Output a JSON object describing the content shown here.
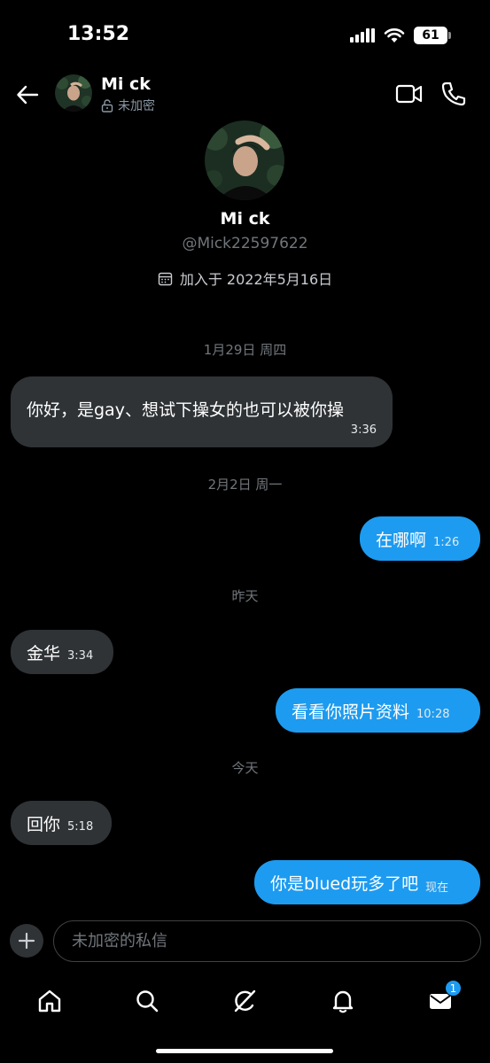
{
  "status_bar": {
    "time": "13:52",
    "battery": "61"
  },
  "header": {
    "name": "Mi ck",
    "encryption_status": "未加密",
    "icons": {
      "back": "back-arrow-icon",
      "video": "video-call-icon",
      "phone": "phone-call-icon",
      "lock": "unlock-icon"
    }
  },
  "profile": {
    "name": "Mi ck",
    "handle": "@Mick22597622",
    "joined": "加入于 2022年5月16日"
  },
  "messages": [
    {
      "type": "date",
      "text": "1月29日 周四"
    },
    {
      "type": "received",
      "text": "你好，是gay、想试下操女的也可以被你操",
      "time": "3:36"
    },
    {
      "type": "date",
      "text": "2月2日 周一"
    },
    {
      "type": "sent",
      "text": "在哪啊",
      "time": "1:26"
    },
    {
      "type": "date",
      "text": "昨天"
    },
    {
      "type": "received",
      "text": "金华",
      "time": "3:34"
    },
    {
      "type": "sent",
      "text": "看看你照片资料",
      "time": "10:28"
    },
    {
      "type": "date",
      "text": "今天"
    },
    {
      "type": "received",
      "text": "回你",
      "time": "5:18"
    },
    {
      "type": "sent",
      "text": "你是blued玩多了吧",
      "time": "现在"
    }
  ],
  "composer": {
    "placeholder": "未加密的私信"
  },
  "tab_bar": {
    "items": [
      "home-icon",
      "search-icon",
      "grok-icon",
      "notifications-icon",
      "messages-icon"
    ],
    "messages_badge": "1"
  },
  "colors": {
    "background": "#000000",
    "sent_bubble": "#1d9bf0",
    "received_bubble": "#2f3336",
    "muted_text": "#71767b"
  }
}
